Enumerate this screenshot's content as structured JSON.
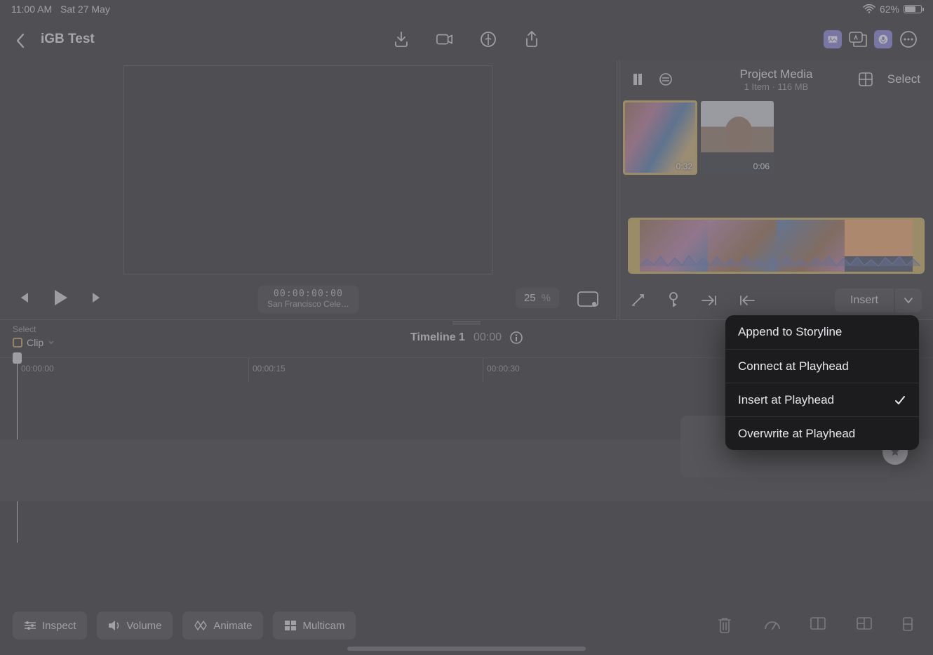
{
  "status": {
    "time": "11:00 AM",
    "date": "Sat 27 May",
    "battery_pct": "62%"
  },
  "header": {
    "project_title": "iGB Test"
  },
  "viewer": {
    "timecode": "00:00:00:00",
    "clip_name": "San Francisco Cele…",
    "zoom": "25",
    "zoom_unit": "%"
  },
  "browser": {
    "title": "Project Media",
    "meta_items": "1 Item",
    "meta_sep": "·",
    "meta_size": "116 MB",
    "select_label": "Select",
    "clips": [
      {
        "duration": "0:32",
        "selected": true
      },
      {
        "duration": "0:06",
        "selected": false
      }
    ],
    "insert_label": "Insert"
  },
  "insert_menu": {
    "items": [
      {
        "label": "Append to Storyline",
        "checked": false
      },
      {
        "label": "Connect at Playhead",
        "checked": false
      },
      {
        "label": "Insert at Playhead",
        "checked": true
      },
      {
        "label": "Overwrite at Playhead",
        "checked": false
      }
    ]
  },
  "timeline": {
    "select_label": "Select",
    "clip_label": "Clip",
    "name": "Timeline 1",
    "time": "00:00",
    "ruler": [
      "00:00:00",
      "00:00:15",
      "00:00:30"
    ]
  },
  "bottom": {
    "inspect": "Inspect",
    "volume": "Volume",
    "animate": "Animate",
    "multicam": "Multicam"
  }
}
